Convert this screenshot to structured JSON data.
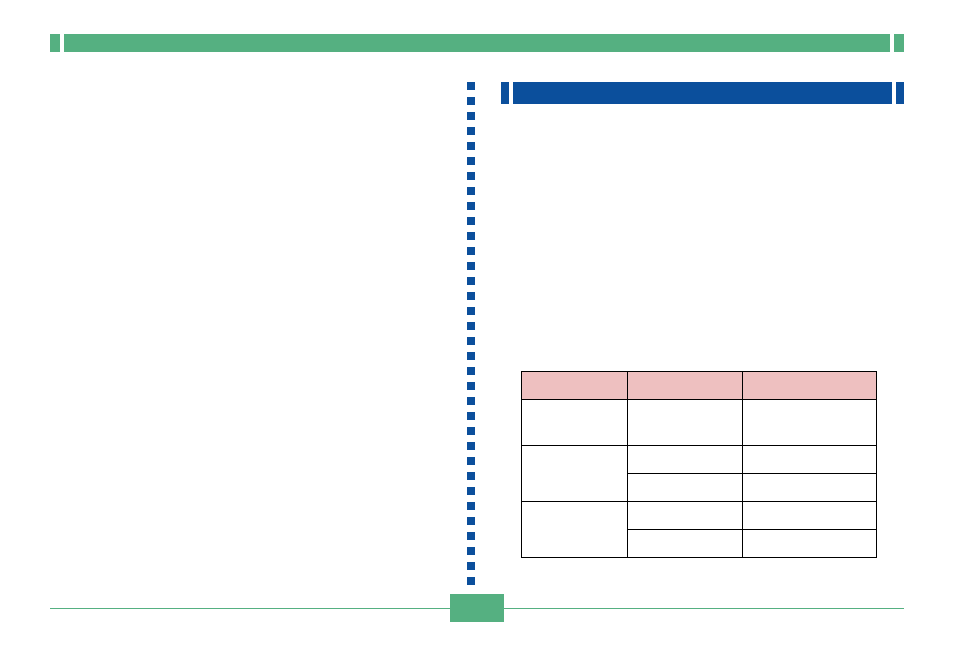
{
  "header": {
    "title": ""
  },
  "subheader": {
    "title": ""
  },
  "table": {
    "headers": [
      "",
      "",
      ""
    ],
    "rows": [
      {
        "cells": [
          "",
          "",
          ""
        ],
        "rowspan": [
          1,
          1,
          1
        ]
      },
      {
        "cells": [
          "",
          "",
          ""
        ],
        "rowspan": [
          2,
          1,
          1
        ]
      },
      {
        "cells": [
          "",
          ""
        ],
        "rowspan": [
          1,
          1
        ]
      },
      {
        "cells": [
          "",
          "",
          ""
        ],
        "rowspan": [
          2,
          1,
          1
        ]
      },
      {
        "cells": [
          "",
          ""
        ],
        "rowspan": [
          1,
          1
        ]
      }
    ]
  },
  "footer": {
    "page": ""
  }
}
